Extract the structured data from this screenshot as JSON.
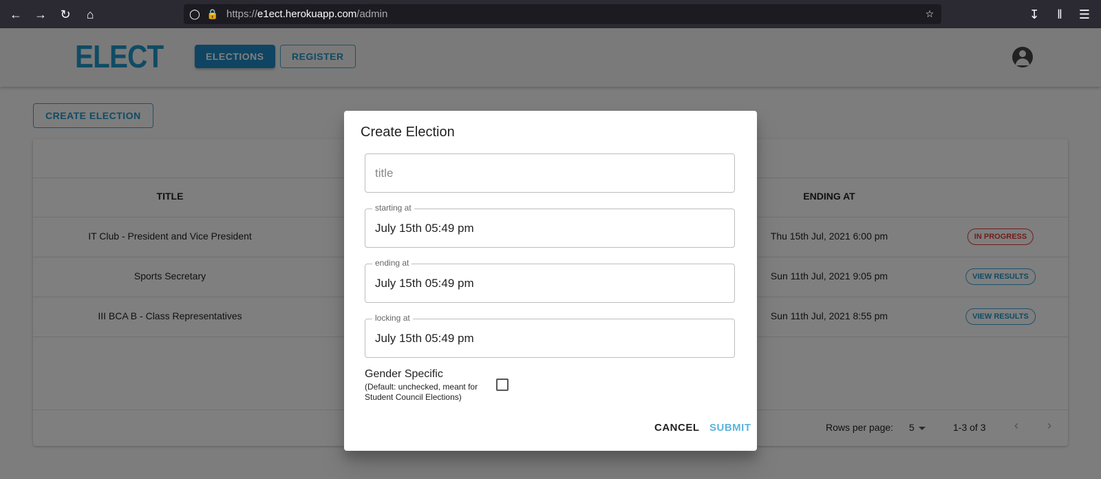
{
  "browser": {
    "url_prefix": "https://",
    "url_host": "e1ect.herokuapp.com",
    "url_path": "/admin",
    "icons": [
      "back-icon",
      "forward-icon",
      "reload-icon",
      "home-icon",
      "shield-icon",
      "lock-icon",
      "bookmark-star-icon",
      "download-icon",
      "library-icon",
      "menu-icon"
    ]
  },
  "header": {
    "logo": "ELECT",
    "nav": {
      "elections": "ELECTIONS",
      "register": "REGISTER"
    },
    "account_icon": "account-circle-icon"
  },
  "main": {
    "create_button": "CREATE ELECTION",
    "table": {
      "columns": {
        "title": "TITLE",
        "ending": "ENDING AT"
      },
      "rows": [
        {
          "title": "IT Club - President and Vice President",
          "ending": "Thu 15th Jul, 2021 6:00 pm",
          "status": "IN PROGRESS",
          "status_color": "#e53935"
        },
        {
          "title": "Sports Secretary",
          "ending": "Sun 11th Jul, 2021 9:05 pm",
          "status": "VIEW RESULTS",
          "status_color": "#2196c9"
        },
        {
          "title": "III BCA B - Class Representatives",
          "ending": "Sun 11th Jul, 2021 8:55 pm",
          "status": "VIEW RESULTS",
          "status_color": "#2196c9"
        }
      ],
      "footer": {
        "rows_per_page_label": "Rows per page:",
        "rows_per_page_value": "5",
        "range": "1-3 of 3"
      }
    }
  },
  "dialog": {
    "title": "Create Election",
    "title_field": {
      "placeholder": "title",
      "value": ""
    },
    "starting_field": {
      "label": "starting at",
      "value": "July 15th 05:49 pm"
    },
    "ending_field": {
      "label": "ending at",
      "value": "July 15th 05:49 pm"
    },
    "locking_field": {
      "label": "locking at",
      "value": "July 15th 05:49 pm"
    },
    "gender": {
      "label": "Gender Specific",
      "hint": "(Default: unchecked, meant for Student Council Elections)",
      "checked": false
    },
    "cancel": "CANCEL",
    "submit": "SUBMIT"
  },
  "colors": {
    "accent": "#2196c9",
    "danger": "#e53935",
    "browser_bar": "#2b2a33"
  }
}
